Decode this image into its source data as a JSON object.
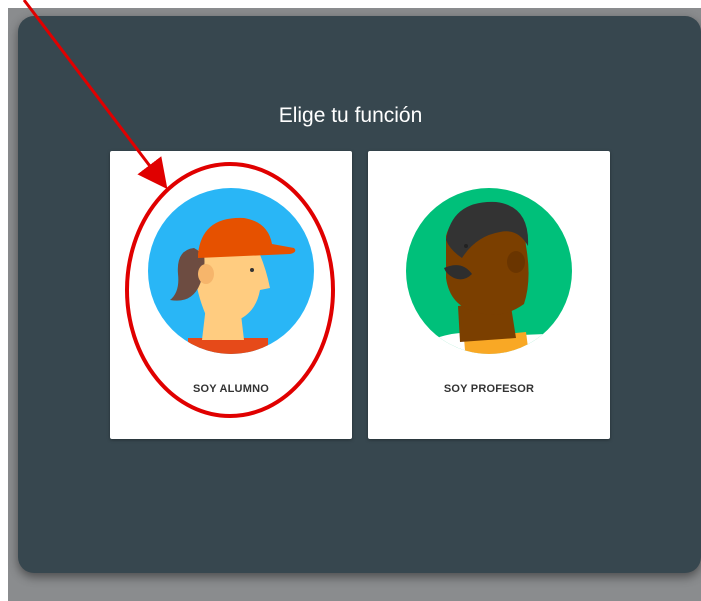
{
  "dialog": {
    "title": "Elige tu función"
  },
  "roles": [
    {
      "label": "SOY ALUMNO",
      "avatar": "student-avatar-icon"
    },
    {
      "label": "SOY PROFESOR",
      "avatar": "teacher-avatar-icon"
    }
  ],
  "colors": {
    "panel": "#37474f",
    "student_circle": "#29b6f6",
    "teacher_circle": "#00c07a",
    "annotation": "#e00000"
  }
}
